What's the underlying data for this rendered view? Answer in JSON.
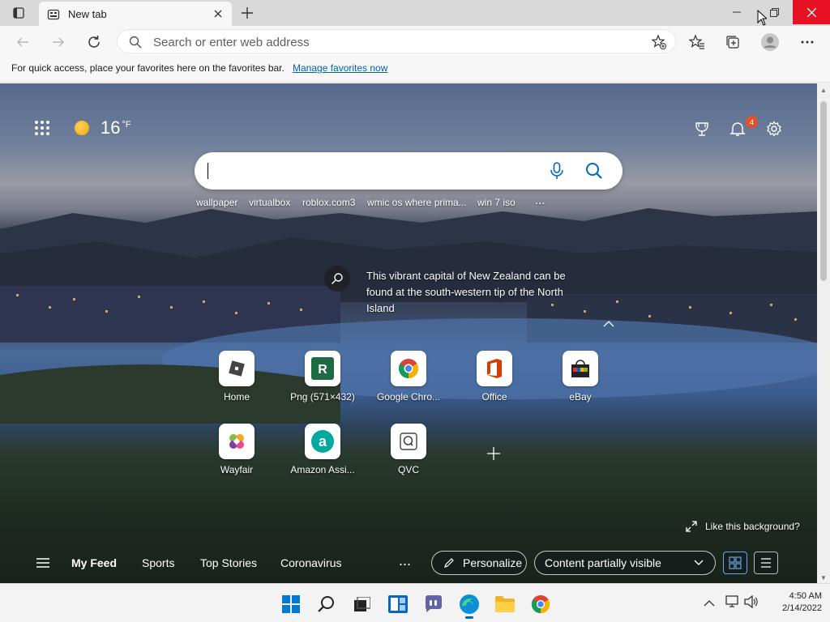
{
  "tab": {
    "title": "New tab"
  },
  "address": {
    "placeholder": "Search or enter web address"
  },
  "favorites_bar": {
    "message": "For quick access, place your favorites here on the favorites bar.",
    "link": "Manage favorites now"
  },
  "weather": {
    "temp": "16",
    "unit": "°F",
    "icon": "sun-icon"
  },
  "notifications": {
    "count": "4"
  },
  "trending": [
    "wallpaper",
    "virtualbox",
    "roblox.com3",
    "wmic os where prima...",
    "win 7 iso"
  ],
  "trending_more": "...",
  "background_info": {
    "text": "This vibrant capital of New Zealand can be found at the south-western tip of the North Island"
  },
  "quick_links": [
    {
      "label": "Home",
      "icon": "roblox-icon"
    },
    {
      "label": "Png (571×432)",
      "icon": "r-letter-icon"
    },
    {
      "label": "Google Chro...",
      "icon": "chrome-icon"
    },
    {
      "label": "Office",
      "icon": "office-icon"
    },
    {
      "label": "eBay",
      "icon": "ebay-icon"
    },
    {
      "label": "Wayfair",
      "icon": "wayfair-icon"
    },
    {
      "label": "Amazon Assi...",
      "icon": "amazon-icon"
    },
    {
      "label": "QVC",
      "icon": "qvc-icon"
    }
  ],
  "like_background": "Like this background?",
  "feed": {
    "items": [
      "My Feed",
      "Sports",
      "Top Stories",
      "Coronavirus"
    ],
    "more": "...",
    "personalize": "Personalize",
    "visibility": "Content partially visible"
  },
  "clock": {
    "time": "4:50 AM",
    "date": "2/14/2022"
  },
  "colors": {
    "accent": "#0067c0",
    "close": "#e81123",
    "badge": "#e3502c"
  }
}
